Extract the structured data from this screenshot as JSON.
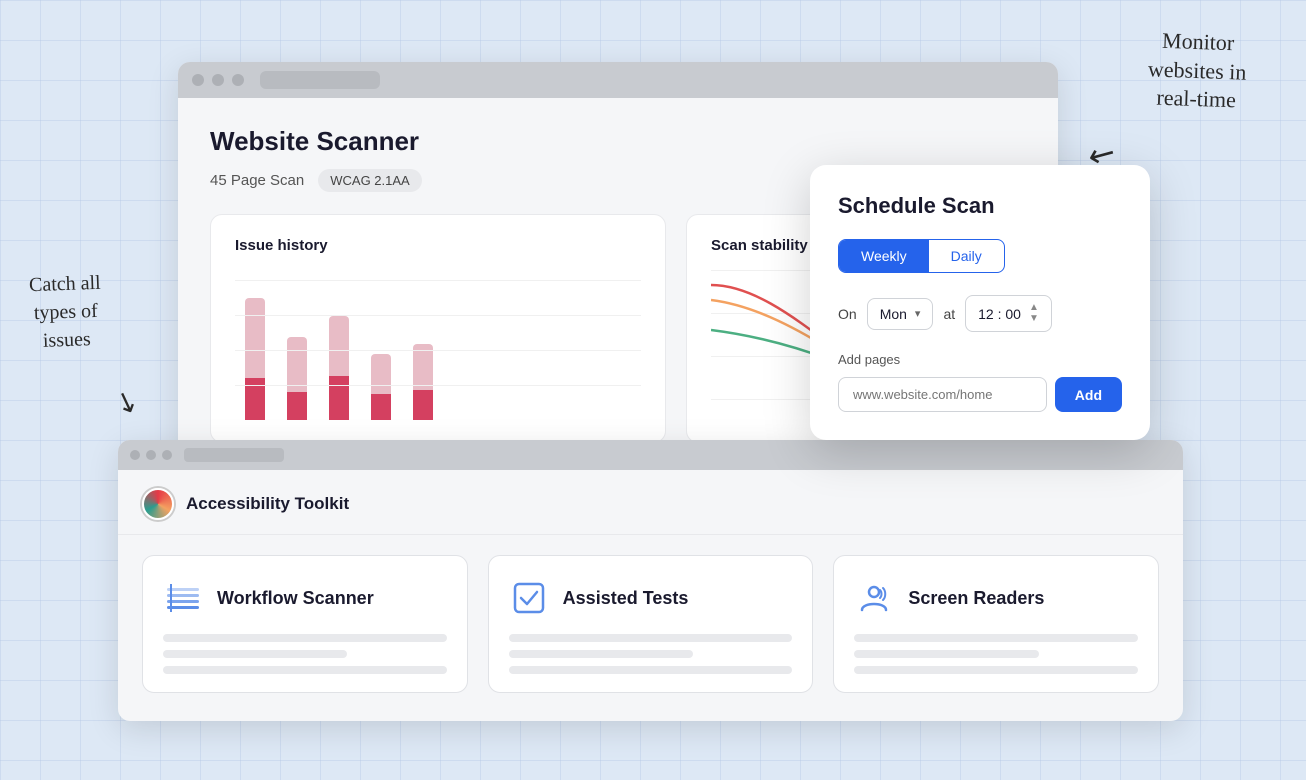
{
  "annotations": {
    "top_right": "Monitor\nwebsites in\nreal-time",
    "left": "Catch all\ntypes of\nissues"
  },
  "browser_top": {
    "page_title": "Website Scanner",
    "scan_count": "45 Page Scan",
    "badge": "WCAG 2.1AA",
    "issue_history": {
      "title": "Issue history",
      "bars": [
        {
          "top_height": 80,
          "bottom_height": 40,
          "top_color": "#e8c0c8",
          "bottom_color": "#d44060"
        },
        {
          "top_height": 55,
          "bottom_height": 30,
          "top_color": "#e8c0c8",
          "bottom_color": "#d44060"
        },
        {
          "top_height": 65,
          "bottom_height": 45,
          "top_color": "#e8c0c8",
          "bottom_color": "#d44060"
        },
        {
          "top_height": 45,
          "bottom_height": 25,
          "top_color": "#e8c0c8",
          "bottom_color": "#d44060"
        },
        {
          "top_height": 50,
          "bottom_height": 30,
          "top_color": "#e8c0c8",
          "bottom_color": "#d44060"
        }
      ]
    },
    "scan_stability": {
      "title": "Scan stability"
    }
  },
  "schedule_popup": {
    "title": "Schedule Scan",
    "weekly_label": "Weekly",
    "daily_label": "Daily",
    "on_label": "On",
    "day_value": "Mon",
    "at_label": "at",
    "time_value": "12 : 00",
    "add_pages_label": "Add pages",
    "url_placeholder": "www.website.com/home",
    "add_button_label": "Add"
  },
  "browser_bottom": {
    "toolkit_title": "Accessibility Toolkit",
    "cards": [
      {
        "id": "workflow-scanner",
        "title": "Workflow Scanner",
        "icon": "⬛"
      },
      {
        "id": "assisted-tests",
        "title": "Assisted Tests",
        "icon": "☑"
      },
      {
        "id": "screen-readers",
        "title": "Screen Readers",
        "icon": "👤"
      }
    ]
  }
}
